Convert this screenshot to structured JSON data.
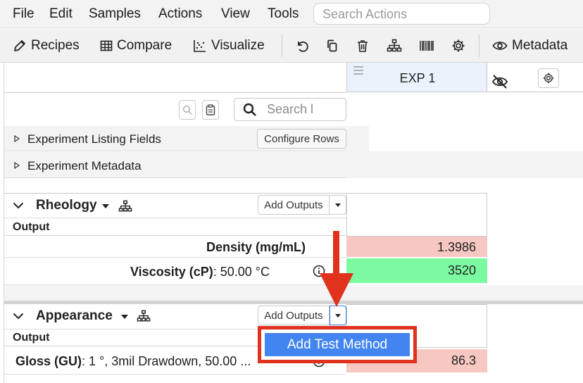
{
  "menu": {
    "items": [
      "File",
      "Edit",
      "Samples",
      "Actions",
      "View",
      "Tools"
    ],
    "search_placeholder": "Search Actions"
  },
  "toolbar": {
    "recipes": "Recipes",
    "compare": "Compare",
    "visualize": "Visualize",
    "metadata": "Metadata",
    "icons": [
      "undo-icon",
      "copy-icon",
      "trash-icon",
      "hierarchy-icon",
      "barcode-icon",
      "gear-icon"
    ]
  },
  "grid": {
    "experiment_header": "EXP 1",
    "search_placeholder": "Search l",
    "sections": {
      "listing_fields": "Experiment Listing Fields",
      "configure_rows": "Configure Rows",
      "metadata": "Experiment Metadata"
    }
  },
  "groups": {
    "rheology": {
      "name": "Rheology",
      "add_outputs": "Add Outputs",
      "output_label": "Output",
      "rows": [
        {
          "label": "Density (mg/mL)",
          "suffix": "",
          "value": "1.3986",
          "color": "#f7c8c2"
        },
        {
          "label": "Viscosity (cP)",
          "suffix": ": 50.00 °C",
          "value": "3520",
          "color": "#7cfaa1"
        }
      ]
    },
    "appearance": {
      "name": "Appearance",
      "add_outputs": "Add Outputs",
      "output_label": "Output",
      "rows": [
        {
          "label": "Gloss (GU)",
          "suffix": ": 1 °, 3mil Drawdown, 50.00 ...",
          "value": "86.3",
          "color": "#f7c8c2"
        }
      ]
    }
  },
  "dropdown": {
    "add_test_method": "Add Test Method"
  },
  "colors": {
    "accent": "#4285f0",
    "highlight": "#e0321d",
    "header_tint": "#eaf2fb"
  }
}
